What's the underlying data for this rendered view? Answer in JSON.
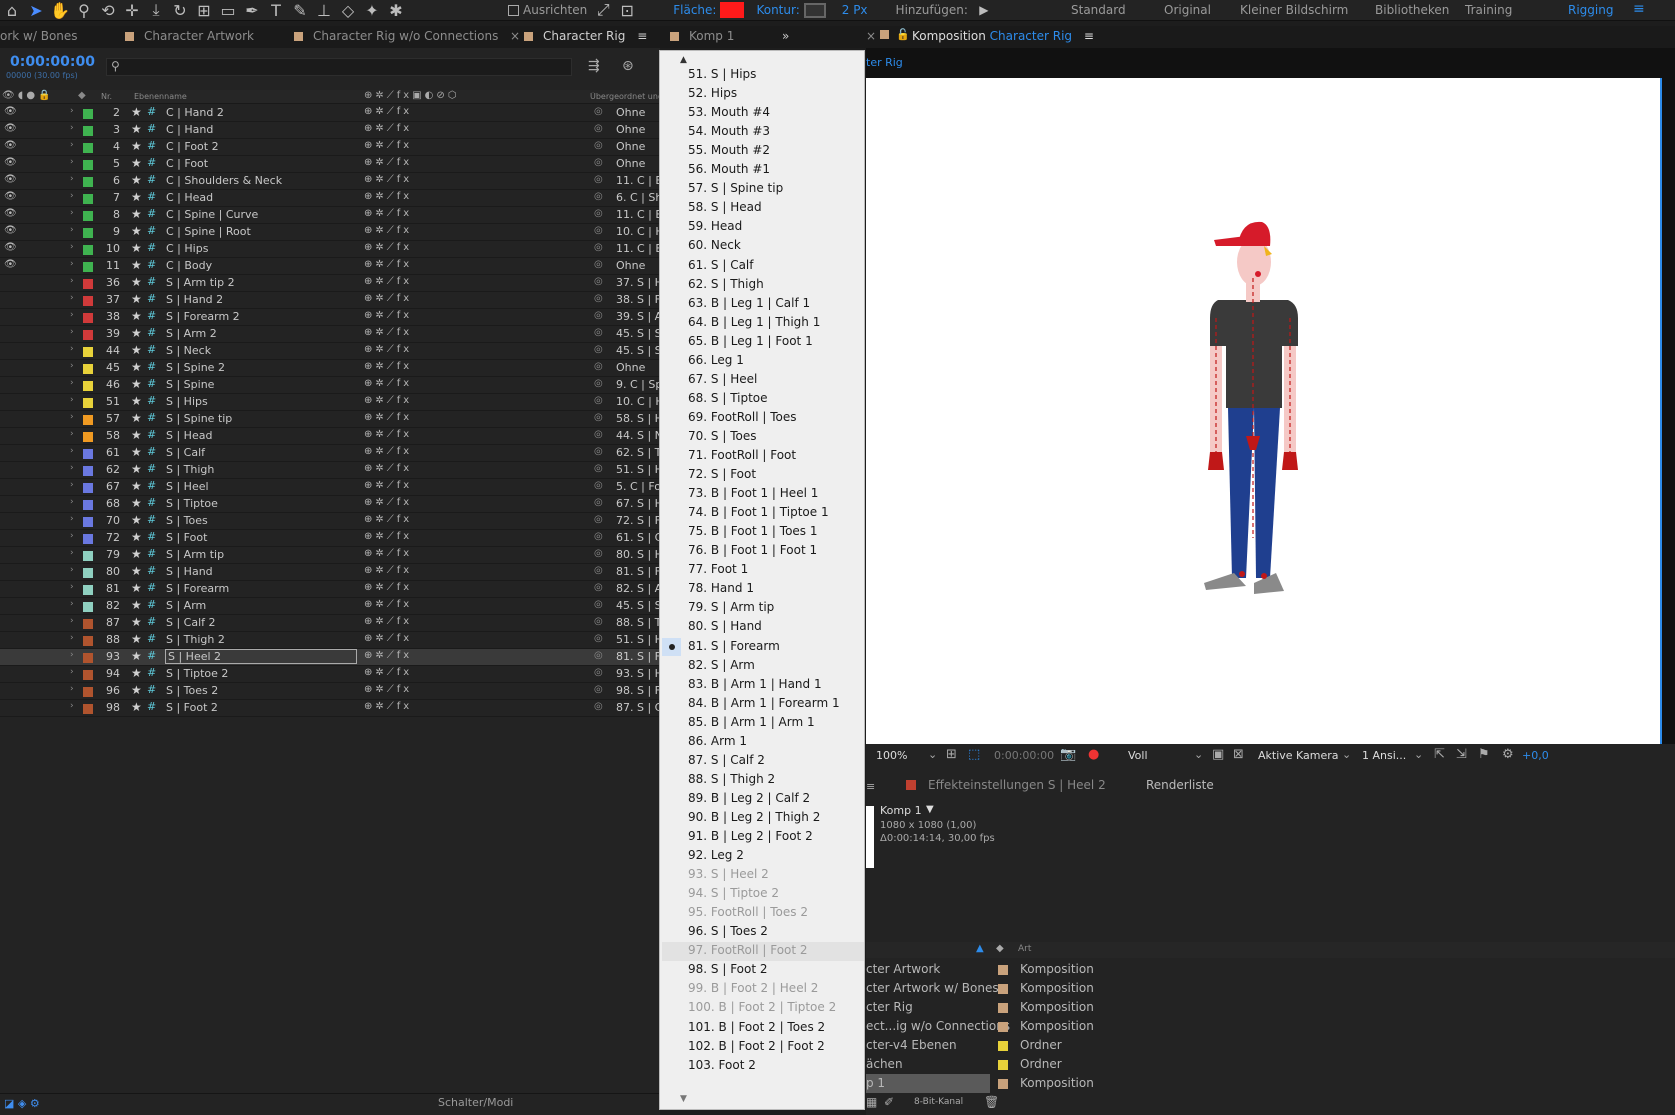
{
  "toolbar": {
    "snap_label": "Ausrichten",
    "fill_label": "Fläche:",
    "fill_color": "#ff1a1a",
    "stroke_label": "Kontur:",
    "stroke_width": "2 Px",
    "add_label": "Hinzufügen:",
    "workspaces": [
      "Standard",
      "Original",
      "Kleiner Bildschirm",
      "Bibliotheken",
      "Training",
      "Rigging"
    ],
    "active_workspace": "Rigging"
  },
  "tabs": [
    {
      "label": "ork w/ Bones"
    },
    {
      "label": "Character Artwork"
    },
    {
      "label": "Character Rig w/o Connections"
    },
    {
      "label": "Character Rig"
    },
    {
      "label": "Komp 1"
    }
  ],
  "timeline": {
    "timecode": "0:00:00:00",
    "fps_sub": "00000 (30.00 fps)",
    "headers": {
      "nr": "Nr.",
      "name": "Ebenenname",
      "parent": "Übergeordnet und..."
    },
    "layers": [
      {
        "nr": "2",
        "name": "C | Hand 2",
        "color": "#3fb350",
        "visible": true,
        "parent": "Ohne"
      },
      {
        "nr": "3",
        "name": "C | Hand",
        "color": "#3fb350",
        "visible": true,
        "parent": "Ohne"
      },
      {
        "nr": "4",
        "name": "C | Foot 2",
        "color": "#3fb350",
        "visible": true,
        "parent": "Ohne"
      },
      {
        "nr": "5",
        "name": "C | Foot",
        "color": "#3fb350",
        "visible": true,
        "parent": "Ohne"
      },
      {
        "nr": "6",
        "name": "C | Shoulders & Neck",
        "color": "#3fb350",
        "visible": true,
        "parent": "11. C | Bo"
      },
      {
        "nr": "7",
        "name": "C | Head",
        "color": "#3fb350",
        "visible": true,
        "parent": "6. C | Sho"
      },
      {
        "nr": "8",
        "name": "C | Spine | Curve",
        "color": "#3fb350",
        "visible": true,
        "parent": "11. C | Bo"
      },
      {
        "nr": "9",
        "name": "C | Spine | Root",
        "color": "#3fb350",
        "visible": true,
        "parent": "10. C | Hi"
      },
      {
        "nr": "10",
        "name": "C | Hips",
        "color": "#3fb350",
        "visible": true,
        "parent": "11. C | Bo"
      },
      {
        "nr": "11",
        "name": "C | Body",
        "color": "#3fb350",
        "visible": true,
        "parent": "Ohne"
      },
      {
        "nr": "36",
        "name": "S | Arm tip 2",
        "color": "#d03a3a",
        "visible": false,
        "parent": "37. S | H"
      },
      {
        "nr": "37",
        "name": "S | Hand 2",
        "color": "#d03a3a",
        "visible": false,
        "parent": "38. S | Fo"
      },
      {
        "nr": "38",
        "name": "S | Forearm 2",
        "color": "#d03a3a",
        "visible": false,
        "parent": "39. S | Ar"
      },
      {
        "nr": "39",
        "name": "S | Arm 2",
        "color": "#d03a3a",
        "visible": false,
        "parent": "45. S | Sp"
      },
      {
        "nr": "44",
        "name": "S | Neck",
        "color": "#e8d23a",
        "visible": false,
        "parent": "45. S | Sp"
      },
      {
        "nr": "45",
        "name": "S | Spine 2",
        "color": "#e8d23a",
        "visible": false,
        "parent": "Ohne"
      },
      {
        "nr": "46",
        "name": "S | Spine",
        "color": "#e8d23a",
        "visible": false,
        "parent": "9. C | Spi"
      },
      {
        "nr": "51",
        "name": "S | Hips",
        "color": "#e8d23a",
        "visible": false,
        "parent": "10. C | Hi"
      },
      {
        "nr": "57",
        "name": "S | Spine tip",
        "color": "#f09a22",
        "visible": false,
        "parent": "58. S | H"
      },
      {
        "nr": "58",
        "name": "S | Head",
        "color": "#f09a22",
        "visible": false,
        "parent": "44. S | N"
      },
      {
        "nr": "61",
        "name": "S | Calf",
        "color": "#6a78e0",
        "visible": false,
        "parent": "62. S | Th"
      },
      {
        "nr": "62",
        "name": "S | Thigh",
        "color": "#6a78e0",
        "visible": false,
        "parent": "51. S | H"
      },
      {
        "nr": "67",
        "name": "S | Heel",
        "color": "#6a78e0",
        "visible": false,
        "parent": "5. C | Fo"
      },
      {
        "nr": "68",
        "name": "S | Tiptoe",
        "color": "#6a78e0",
        "visible": false,
        "parent": "67. S | H"
      },
      {
        "nr": "70",
        "name": "S | Toes",
        "color": "#6a78e0",
        "visible": false,
        "parent": "72. S | Fo"
      },
      {
        "nr": "72",
        "name": "S | Foot",
        "color": "#6a78e0",
        "visible": false,
        "parent": "61. S | Ca"
      },
      {
        "nr": "79",
        "name": "S | Arm tip",
        "color": "#8fd0c0",
        "visible": false,
        "parent": "80. S | H"
      },
      {
        "nr": "80",
        "name": "S | Hand",
        "color": "#8fd0c0",
        "visible": false,
        "parent": "81. S | Fo"
      },
      {
        "nr": "81",
        "name": "S | Forearm",
        "color": "#8fd0c0",
        "visible": false,
        "parent": "82. S | Ar"
      },
      {
        "nr": "82",
        "name": "S | Arm",
        "color": "#8fd0c0",
        "visible": false,
        "parent": "45. S | Sp"
      },
      {
        "nr": "87",
        "name": "S | Calf 2",
        "color": "#b0542e",
        "visible": false,
        "parent": "88. S | Th"
      },
      {
        "nr": "88",
        "name": "S | Thigh 2",
        "color": "#b0542e",
        "visible": false,
        "parent": "51. S | H"
      },
      {
        "nr": "93",
        "name": "S | Heel 2",
        "color": "#b0542e",
        "visible": false,
        "parent": "81. S | Fo",
        "selected": true
      },
      {
        "nr": "94",
        "name": "S | Tiptoe 2",
        "color": "#b0542e",
        "visible": false,
        "parent": "93. S | H"
      },
      {
        "nr": "96",
        "name": "S | Toes 2",
        "color": "#b0542e",
        "visible": false,
        "parent": "98. S | Fo"
      },
      {
        "nr": "98",
        "name": "S | Foot 2",
        "color": "#b0542e",
        "visible": false,
        "parent": "87. S | Ca"
      }
    ],
    "footer_label": "Schalter/Modi"
  },
  "parent_menu": {
    "selected": "81. S | Forearm",
    "hovered": "97. FootRoll | Foot 2",
    "items": [
      {
        "label": "51. S | Hips"
      },
      {
        "label": "52. Hips"
      },
      {
        "label": "53. Mouth #4"
      },
      {
        "label": "54. Mouth #3"
      },
      {
        "label": "55. Mouth #2"
      },
      {
        "label": "56. Mouth #1"
      },
      {
        "label": "57. S | Spine tip"
      },
      {
        "label": "58. S | Head"
      },
      {
        "label": "59. Head"
      },
      {
        "label": "60. Neck"
      },
      {
        "label": "61. S | Calf"
      },
      {
        "label": "62. S | Thigh"
      },
      {
        "label": "63. B | Leg 1 | Calf 1"
      },
      {
        "label": "64. B | Leg 1 | Thigh 1"
      },
      {
        "label": "65. B | Leg 1 | Foot 1"
      },
      {
        "label": "66. Leg 1"
      },
      {
        "label": "67. S | Heel"
      },
      {
        "label": "68. S | Tiptoe"
      },
      {
        "label": "69. FootRoll | Toes"
      },
      {
        "label": "70. S | Toes"
      },
      {
        "label": "71. FootRoll | Foot"
      },
      {
        "label": "72. S | Foot"
      },
      {
        "label": "73. B | Foot 1 | Heel 1"
      },
      {
        "label": "74. B | Foot 1 | Tiptoe 1"
      },
      {
        "label": "75. B | Foot 1 | Toes 1"
      },
      {
        "label": "76. B | Foot 1 | Foot 1"
      },
      {
        "label": "77. Foot 1"
      },
      {
        "label": "78. Hand 1"
      },
      {
        "label": "79. S | Arm tip"
      },
      {
        "label": "80. S | Hand"
      },
      {
        "label": "81. S | Forearm"
      },
      {
        "label": "82. S | Arm"
      },
      {
        "label": "83. B | Arm 1 | Hand 1"
      },
      {
        "label": "84. B | Arm 1 | Forearm 1"
      },
      {
        "label": "85. B | Arm 1 | Arm 1"
      },
      {
        "label": "86. Arm 1"
      },
      {
        "label": "87. S | Calf 2"
      },
      {
        "label": "88. S | Thigh 2"
      },
      {
        "label": "89. B | Leg 2 | Calf 2"
      },
      {
        "label": "90. B | Leg 2 | Thigh 2"
      },
      {
        "label": "91. B | Leg 2 | Foot 2"
      },
      {
        "label": "92. Leg 2"
      },
      {
        "label": "93. S | Heel 2",
        "disabled": true
      },
      {
        "label": "94. S | Tiptoe 2",
        "disabled": true
      },
      {
        "label": "95. FootRoll | Toes 2",
        "disabled": true
      },
      {
        "label": "96. S | Toes 2"
      },
      {
        "label": "97. FootRoll | Foot 2",
        "disabled": true
      },
      {
        "label": "98. S | Foot 2"
      },
      {
        "label": "99. B | Foot 2 | Heel 2",
        "disabled": true
      },
      {
        "label": "100. B | Foot 2 | Tiptoe 2",
        "disabled": true
      },
      {
        "label": "101. B | Foot 2 | Toes 2"
      },
      {
        "label": "102. B | Foot 2 | Foot 2"
      },
      {
        "label": "103. Foot 2"
      }
    ]
  },
  "composition": {
    "tab_prefix": "Komposition",
    "tab_name": "Character Rig",
    "sub_label": "ter Rig",
    "zoom": "100%",
    "timecode": "0:00:00:00",
    "resolution": "Voll",
    "camera": "Aktive Kamera",
    "views": "1 Ansi...",
    "exposure": "+0,0"
  },
  "effects_panel": {
    "title": "Effekteinstellungen S | Heel 2",
    "render_tab": "Renderliste",
    "comp_name": "Komp 1",
    "size": "1080 x 1080 (1,00)",
    "duration": "Δ0:00:14:14, 30,00 fps"
  },
  "project": {
    "col_type": "Art",
    "bit_depth": "8-Bit-Kanal",
    "items": [
      {
        "name": "cter Artwork",
        "type": "Komposition",
        "color": "#c9a27c"
      },
      {
        "name": "cter Artwork w/ Bones",
        "type": "Komposition",
        "color": "#c9a27c"
      },
      {
        "name": "cter Rig",
        "type": "Komposition",
        "color": "#c9a27c"
      },
      {
        "name": "ect...ig w/o Connections",
        "type": "Komposition",
        "color": "#c9a27c"
      },
      {
        "name": "cter-v4 Ebenen",
        "type": "Ordner",
        "color": "#e8d23a"
      },
      {
        "name": "ächen",
        "type": "Ordner",
        "color": "#e8d23a"
      },
      {
        "name": "p 1",
        "type": "Komposition",
        "color": "#c9a27c",
        "selected": true
      }
    ]
  }
}
